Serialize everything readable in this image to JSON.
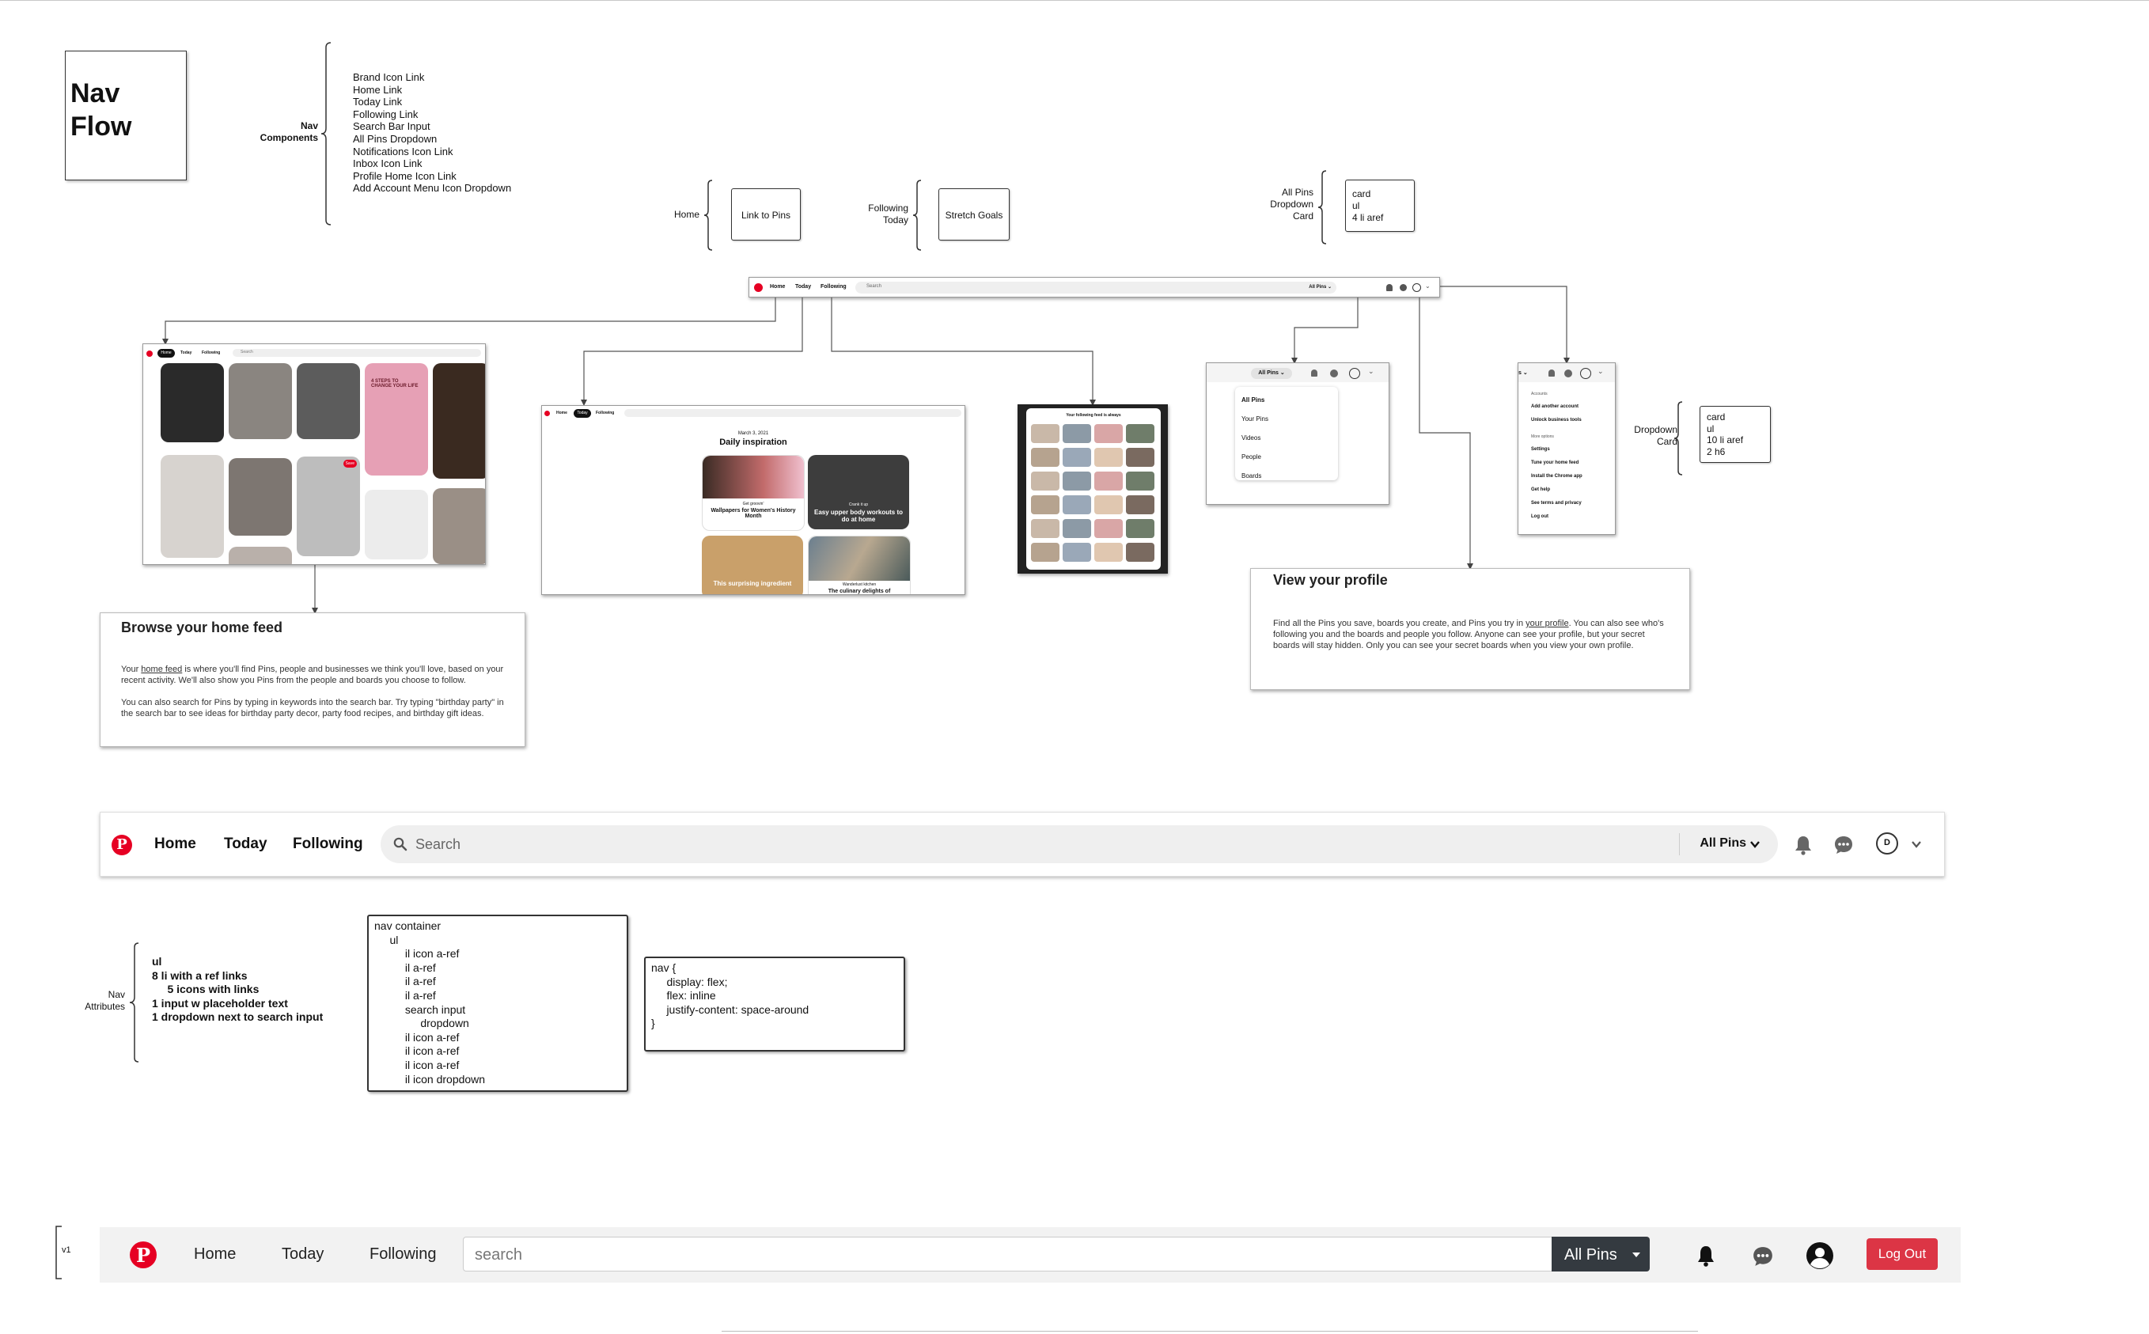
{
  "title": {
    "line1": "Nav",
    "line2": "Flow"
  },
  "nav_components": {
    "label_line1": "Nav",
    "label_line2": "Components",
    "items": [
      "Brand Icon Link",
      "Home Link",
      "Today Link",
      "Following Link",
      "Search Bar Input",
      "All Pins Dropdown",
      "Notifications Icon Link",
      "Inbox Icon Link",
      "Profile Home Icon Link",
      "Add Account Menu Icon Dropdown"
    ]
  },
  "annotations": {
    "home": {
      "label": "Home",
      "box": "Link to Pins"
    },
    "following": {
      "label_line1": "Following",
      "label_line2": "Today",
      "box": "Stretch Goals"
    },
    "allpins": {
      "label_line1": "All Pins",
      "label_line2": "Dropdown",
      "label_line3": "Card",
      "box_lines": [
        "card",
        "ul",
        "4 li aref"
      ]
    },
    "dropdown": {
      "label_line1": "Dropdown",
      "label_line2": "Card",
      "box_lines": [
        "card",
        "ul",
        "10 li aref",
        "2 h6"
      ]
    }
  },
  "mini_nav": {
    "home": "Home",
    "today": "Today",
    "following": "Following",
    "search": "Search",
    "allpins": "All Pins"
  },
  "home_feed_shot": {
    "tabs": [
      "Home",
      "Today",
      "Following"
    ],
    "search": "Search",
    "pink_card_text": "4 STEPS TO CHANGE YOUR LIFE",
    "save_label": "Save"
  },
  "today_shot": {
    "tabs": [
      "Home",
      "Today",
      "Following"
    ],
    "date": "March 3, 2021",
    "heading": "Daily inspiration",
    "tiles": [
      {
        "kicker": "Get groovin'",
        "title": "Wallpapers for Women's History Month"
      },
      {
        "kicker": "Crank it up",
        "title": "Easy upper body workouts to do at home"
      },
      {
        "kicker": "",
        "title": "This surprising ingredient"
      },
      {
        "kicker": "Wanderlust kitchen",
        "title": "The culinary delights of"
      }
    ]
  },
  "following_shot": {
    "heading": "Your following feed is always"
  },
  "allpins_shot": {
    "button": "All Pins",
    "items": [
      "All Pins",
      "Your Pins",
      "Videos",
      "People",
      "Boards"
    ]
  },
  "account_shot": {
    "button": "s",
    "section1": "Accounts",
    "items1": [
      "Add another account",
      "Unlock business tools"
    ],
    "section2": "More options",
    "items2": [
      "Settings",
      "Tune your home feed",
      "Install the Chrome app",
      "Get help",
      "See terms and privacy",
      "Log out"
    ]
  },
  "browse_card": {
    "title": "Browse your home feed",
    "p1_pre": "Your ",
    "p1_link": "home feed",
    "p1_post": " is where you'll find Pins, people and businesses we think you'll love, based on your recent activity. We'll also show you Pins from the people and boards you choose to follow.",
    "p2": "You can also search for Pins by typing in keywords into the search bar. Try typing \"birthday party\" in the search bar to see ideas for birthday party decor, party food recipes, and birthday gift ideas."
  },
  "profile_card": {
    "title": "View your profile",
    "p_pre": "Find all the Pins you save, boards you create, and Pins you try in ",
    "p_link": "your profile",
    "p_post": ". You can also see who's following you and the boards and people you follow. Anyone can see your profile, but your secret boards will stay hidden. Only you can see your secret boards when you view your own profile."
  },
  "big_nav": {
    "home": "Home",
    "today": "Today",
    "following": "Following",
    "search_placeholder": "Search",
    "allpins": "All Pins",
    "avatar_letter": "D"
  },
  "nav_attributes": {
    "label_line1": "Nav",
    "label_line2": "Attributes",
    "lines": [
      "ul",
      "8 li with a ref links",
      "     5 icons with links",
      "1 input w placeholder text",
      "1 dropdown next to search input"
    ]
  },
  "code_structure": "nav container\n     ul\n          il icon a-ref\n          il a-ref\n          il a-ref\n          il a-ref\n          search input\n               dropdown\n          il icon a-ref\n          il icon a-ref\n          il icon a-ref\n          il icon dropdown",
  "code_css": "nav {\n     display: flex;\n     flex: inline\n     justify-content: space-around\n}",
  "v1": {
    "label": "v1",
    "home": "Home",
    "today": "Today",
    "following": "Following",
    "search_placeholder": "search",
    "allpins": "All Pins",
    "logout": "Log Out"
  },
  "colors": {
    "pinterest_red": "#E60023",
    "logout_red": "#dc3545",
    "dark_button": "#343a40"
  }
}
